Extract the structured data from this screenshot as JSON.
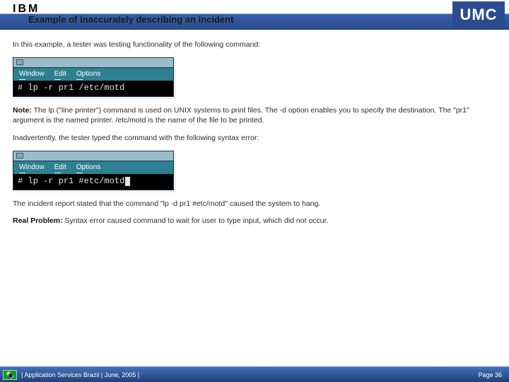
{
  "header": {
    "ibm_logo": "IBM",
    "umc_logo": "UMC",
    "slide_title": "Example of inaccurately describing an incident"
  },
  "body": {
    "intro": "In this example, a tester was testing functionality of the following command:",
    "terminal1": {
      "menu": {
        "window": "Window",
        "edit": "Edit",
        "options": "Options"
      },
      "command": "# lp -r pr1 /etc/motd"
    },
    "note_label": "Note:",
    "note_text": " The lp (\"line printer\") command is used on UNIX systems to print files. The -d option enables you to specify the destination. The \"pr1\" argument is the named printer. /etc/motd is the name of the file to be printed.",
    "inadvertent": "Inadvertently, the tester typed the command with the following syntax error:",
    "terminal2": {
      "menu": {
        "window": "Window",
        "edit": "Edit",
        "options": "Options"
      },
      "command": "# lp -r pr1 #etc/motd"
    },
    "report_line": "The incident report stated that the command \"lp -d pr1 #etc/motd\" caused the system to hang.",
    "real_label": "Real Problem:",
    "real_text": " Syntax error caused command to wait for user to type input, which did not occur."
  },
  "footer": {
    "left": "|  Application Services Brazil  |  June, 2005  |",
    "right": "Page 36"
  }
}
